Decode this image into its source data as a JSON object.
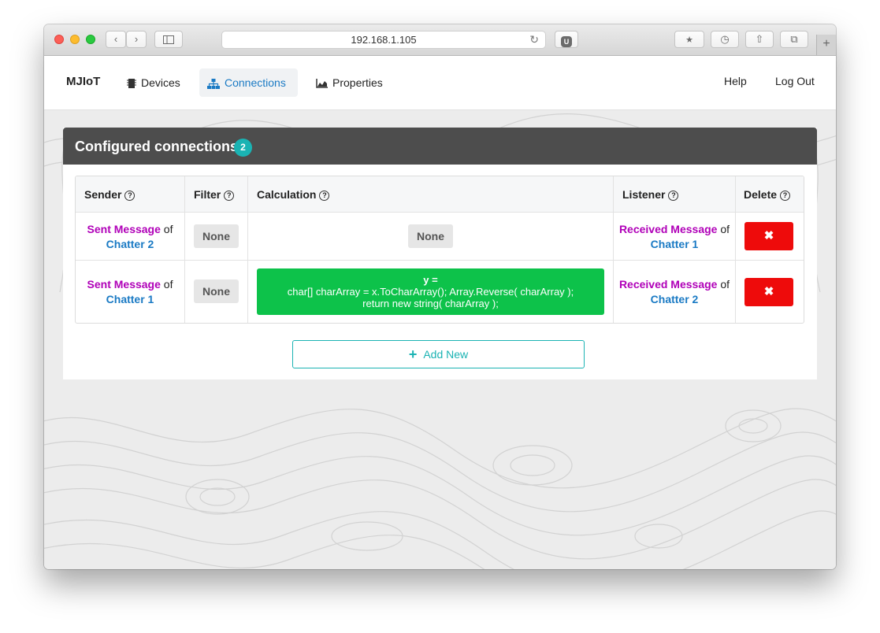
{
  "browser": {
    "url": "192.168.1.105",
    "ublock_label": "U"
  },
  "navbar": {
    "brand": "MJIoT",
    "items": [
      {
        "label": "Devices",
        "icon": "chip-icon"
      },
      {
        "label": "Connections",
        "icon": "sitemap-icon",
        "active": true
      },
      {
        "label": "Properties",
        "icon": "area-chart-icon"
      }
    ],
    "help": "Help",
    "logout": "Log Out"
  },
  "panel": {
    "title": "Configured connections",
    "count": "2"
  },
  "table": {
    "headers": [
      "Sender",
      "Filter",
      "Calculation",
      "Listener",
      "Delete"
    ],
    "rows": [
      {
        "sender_msg": "Sent Message",
        "sender_of": "of",
        "sender_device": "Chatter 2",
        "filter": "None",
        "calculation_none": "None",
        "listener_msg": "Received Message",
        "listener_of": "of",
        "listener_device": "Chatter 1",
        "delete": "✖"
      },
      {
        "sender_msg": "Sent Message",
        "sender_of": "of",
        "sender_device": "Chatter 1",
        "filter": "None",
        "calc_head": "y =",
        "calc_line1": "char[] charArray = x.ToCharArray(); Array.Reverse( charArray );",
        "calc_line2": "return new string( charArray );",
        "listener_msg": "Received Message",
        "listener_of": "of",
        "listener_device": "Chatter 2",
        "delete": "✖"
      }
    ]
  },
  "add_button": {
    "label": "Add New",
    "icon": "plus-icon"
  },
  "colors": {
    "accent": "#1ab3b3",
    "link": "#1a7ac4",
    "message": "#b000b8",
    "danger": "#ee0b0b",
    "calc": "#0dc24a",
    "panel_head": "#4d4d4d"
  }
}
